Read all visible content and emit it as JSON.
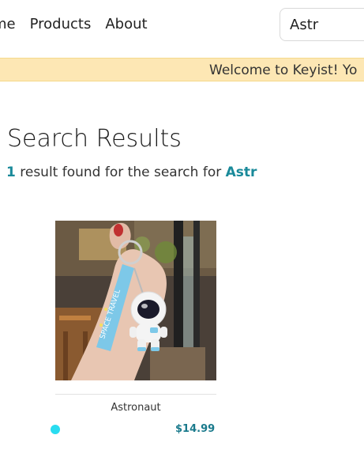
{
  "nav": {
    "links": [
      "ome",
      "Products",
      "About"
    ],
    "search_value": "Astr"
  },
  "banner": {
    "text": "Welcome to Keyist! Yo"
  },
  "results": {
    "title": "Search Results",
    "count": "1",
    "summary_text": " result found for the search for ",
    "query": "Astr"
  },
  "product": {
    "name": "Astronaut",
    "price": "$14.99",
    "color_swatch": "#29dcf0"
  },
  "colors": {
    "accent": "#1a8a9a",
    "banner_bg": "#fde7b4"
  }
}
